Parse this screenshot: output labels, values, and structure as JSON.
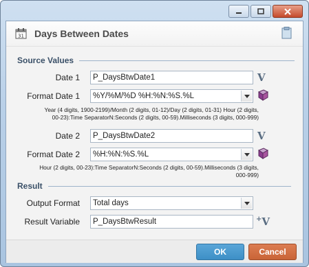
{
  "dialog": {
    "title": "Days Between Dates",
    "source_section": "Source Values",
    "result_section": "Result",
    "date1": {
      "label": "Date 1",
      "value": "P_DaysBtwDate1"
    },
    "format1": {
      "label": "Format Date 1",
      "value": "%Y/%M/%D %H:%N:%S.%L",
      "hint_line1": "Year (4 digits, 1900-2199)/Month (2 digits, 01-12)/Day (2 digits, 01-31) Hour (2 digits,",
      "hint_line2": "00-23):Time SeparatorN:Seconds (2 digits, 00-59).Milliseconds (3 digits, 000-999)"
    },
    "date2": {
      "label": "Date 2",
      "value": "P_DaysBtwDate2"
    },
    "format2": {
      "label": "Format Date 2",
      "value": "%H:%N:%S.%L",
      "hint_line1": "Hour (2 digits, 00-23):Time SeparatorN:Seconds (2 digits, 00-59).Milliseconds (3 digits,",
      "hint_line2": "000-999)"
    },
    "output_format": {
      "label": "Output Format",
      "value": "Total days"
    },
    "result_variable": {
      "label": "Result Variable",
      "value": "P_DaysBtwResult"
    },
    "ok_label": "OK",
    "cancel_label": "Cancel"
  },
  "colors": {
    "ok": "#3d8fc6",
    "cancel": "#c96437",
    "section": "#3a5068"
  },
  "icons": {
    "minimize": "minimize-icon",
    "maximize": "maximize-icon",
    "close": "close-icon",
    "calendar": "calendar-icon",
    "clipboard": "clipboard-icon",
    "variable": "variable-icon",
    "book": "book-icon",
    "dropdown": "chevron-down-icon"
  }
}
